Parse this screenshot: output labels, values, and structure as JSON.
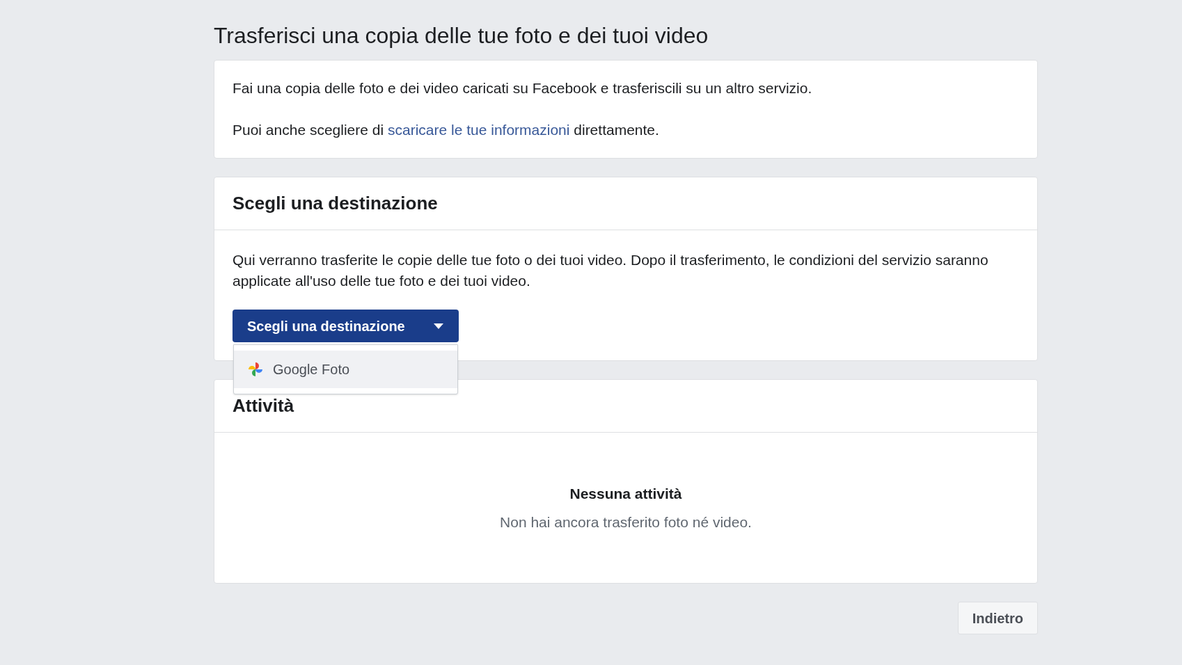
{
  "page_title": "Trasferisci una copia delle tue foto e dei tuoi video",
  "intro": {
    "text": "Fai una copia delle foto e dei video caricati su Facebook e trasferiscili su un altro servizio.",
    "link_prefix": "Puoi anche scegliere di",
    "link": "scaricare le tue informazioni",
    "link_suffix": "direttamente."
  },
  "destination": {
    "heading": "Scegli una destinazione",
    "description": "Qui verranno trasferite le copie delle tue foto o dei tuoi video. Dopo il trasferimento, le condizioni del servizio saranno applicate all'uso delle tue foto e dei tuoi video.",
    "dropdown": {
      "label": "Scegli una destinazione",
      "expanded": true,
      "options": [
        {
          "label": "Google Foto",
          "highlighted": true
        }
      ]
    }
  },
  "activity": {
    "heading": "Attività",
    "empty_title": "Nessuna attività",
    "empty_text": "Non hai ancora trasferito foto né video."
  },
  "back_button": "Indietro"
}
